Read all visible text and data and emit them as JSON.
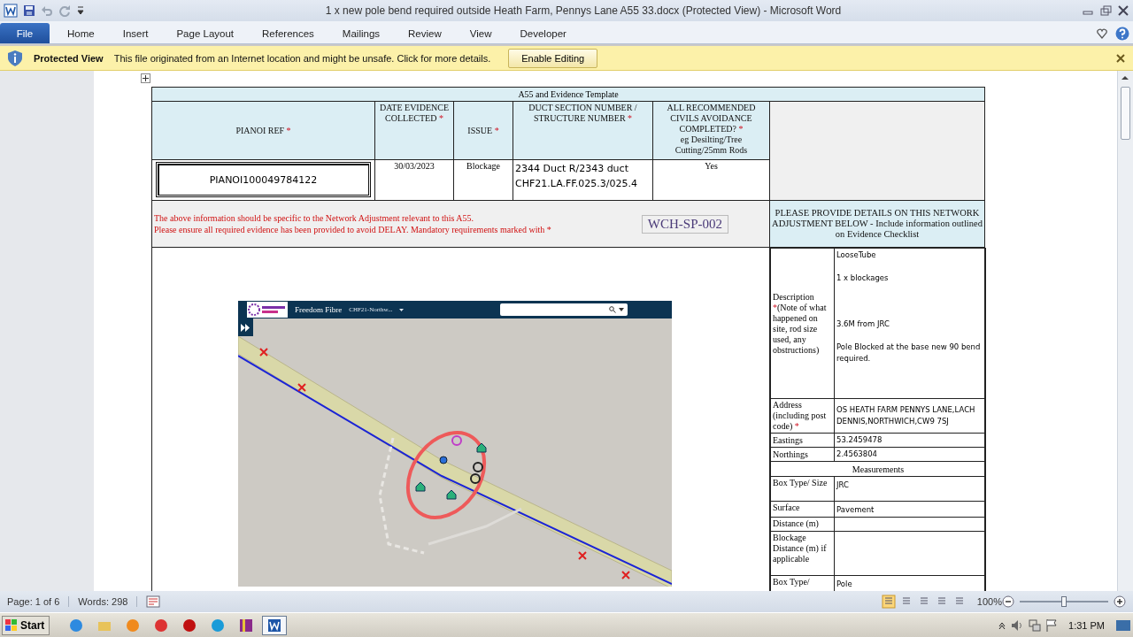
{
  "window": {
    "title": "1 x new pole bend required outside Heath Farm, Pennys Lane A55 33.docx (Protected View)  -  Microsoft Word"
  },
  "ribbon_tabs": [
    {
      "label": "File",
      "selected": true
    },
    {
      "label": "Home",
      "selected": false
    },
    {
      "label": "Insert",
      "selected": false
    },
    {
      "label": "Page Layout",
      "selected": false
    },
    {
      "label": "References",
      "selected": false
    },
    {
      "label": "Mailings",
      "selected": false
    },
    {
      "label": "Review",
      "selected": false
    },
    {
      "label": "View",
      "selected": false
    },
    {
      "label": "Developer",
      "selected": false
    }
  ],
  "protected_view": {
    "title": "Protected View",
    "message": "This file originated from an Internet location and might be unsafe. Click for more details.",
    "button": "Enable Editing"
  },
  "document": {
    "table_title": "A55 and Evidence Template",
    "headers": [
      {
        "label": "PIANOI REF",
        "marker": "*"
      },
      {
        "label": "DATE EVIDENCE COLLECTED",
        "marker": "*"
      },
      {
        "label": "ISSUE",
        "marker": "*"
      },
      {
        "label": "DUCT SECTION NUMBER / STRUCTURE NUMBER",
        "marker": "*"
      },
      {
        "label": "ALL RECOMMENDED CIVILS AVOIDANCE COMPLETED?",
        "marker": "*",
        "note": "eg Desilting/Tree Cutting/25mm Rods"
      }
    ],
    "row": {
      "pianoi_ref": "PIANOI100049784122",
      "date": "30/03/2023",
      "issue": "Blockage",
      "duct": [
        "2344 Duct R/2343 duct",
        "CHF21.LA.FF.025.3/025.4"
      ],
      "civils": "Yes"
    },
    "notice": [
      "The above information should be specific to the Network Adjustment relevant to this A55.",
      "Please ensure all required evidence has been provided to avoid DELAY.  Mandatory requirements marked with *"
    ],
    "code": "WCH-SP-002",
    "details_header": [
      "PLEASE PROVIDE DETAILS ON THIS NETWORK",
      "ADJUSTMENT BELOW - Include information outlined on Evidence Checklist"
    ],
    "map": {
      "app_name": "Freedom Fibre",
      "project": "CHF21-Northw..."
    },
    "details": [
      {
        "label": "Description",
        "marker": "*",
        "note": "(Note of what happened on site, rod size used, any obstructions)",
        "value": [
          "LooseTube",
          "1 x blockages",
          "3.6M from JRC",
          "Pole Blocked at the base new 90 bend required."
        ]
      },
      {
        "label": "Address (including post code)",
        "marker": "*",
        "value": [
          "OS HEATH FARM PENNYS LANE,LACH DENNIS,NORTHWICH,CW9 7SJ"
        ]
      },
      {
        "label": "Eastings",
        "value": [
          "53.2459478"
        ]
      },
      {
        "label": "Northings",
        "value": [
          "2.4563804"
        ]
      }
    ],
    "measurements_header": "Measurements",
    "measurements": [
      {
        "label": "Box Type/ Size",
        "value": "JRC"
      },
      {
        "label": "Surface",
        "value": "Pavement"
      },
      {
        "label": "Distance (m)"
      },
      {
        "label": "Blockage Distance (m) if applicable"
      },
      {
        "label": "Box Type/",
        "value": "Pole"
      }
    ]
  },
  "status_bar": {
    "page": "Page: 1 of 6",
    "words": "Words: 298",
    "zoom": "100%",
    "zoom_level": {
      "level": 0.5
    }
  },
  "taskbar": {
    "start": "Start",
    "time": "1:31 PM"
  }
}
